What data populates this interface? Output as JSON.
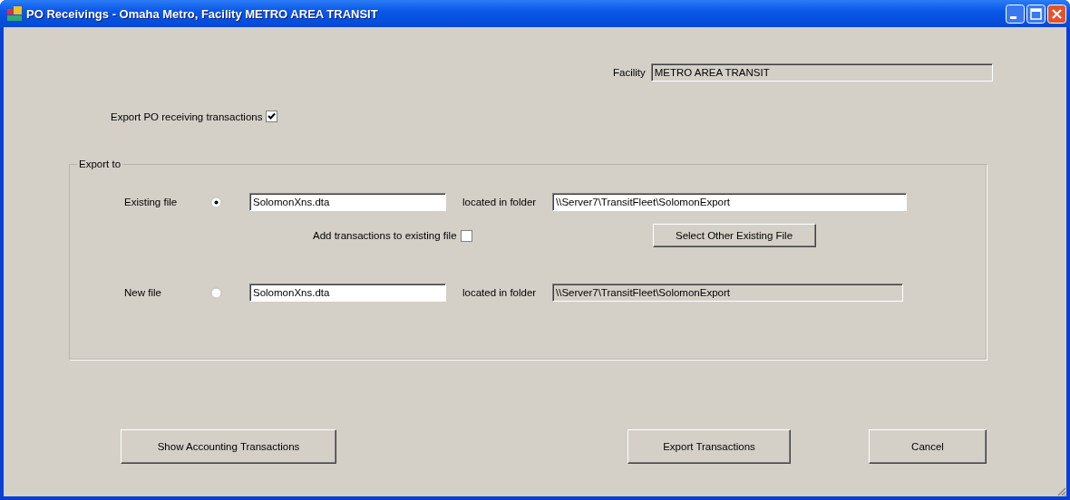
{
  "window": {
    "title": "PO Receivings - Omaha Metro, Facility METRO AREA TRANSIT"
  },
  "facility": {
    "label": "Facility",
    "value": "METRO AREA TRANSIT",
    "disabled": true
  },
  "export_option": {
    "label": "Export PO receiving transactions",
    "checked": true
  },
  "export_to": {
    "title": "Export to",
    "options": [
      {
        "label": "Existing file",
        "selected": true,
        "file_name": "SolomonXns.dta",
        "folder_label": "located in folder",
        "folder": "\\\\Server7\\TransitFleet\\SolomonExport",
        "folder_disabled": false
      },
      {
        "label": "New file",
        "selected": false,
        "file_name": "SolomonXns.dta",
        "folder_label": "located in folder",
        "folder": "\\\\Server7\\TransitFleet\\SolomonExport",
        "folder_disabled": true
      }
    ],
    "append": {
      "label": "Add transactions to existing file",
      "checked": false
    },
    "select_button": "Select Other Existing File"
  },
  "buttons": [
    {
      "label": "Show Accounting Transactions"
    },
    {
      "label": "Export Transactions"
    },
    {
      "label": "Cancel"
    }
  ]
}
